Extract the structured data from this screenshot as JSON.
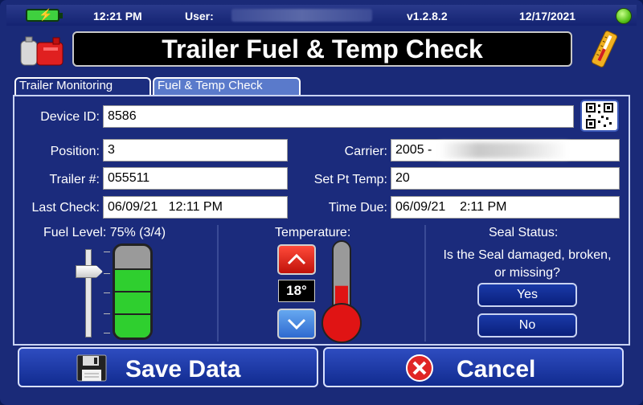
{
  "status": {
    "time": "12:21 PM",
    "user_label": "User:",
    "version": "v1.2.8.2",
    "date": "12/17/2021"
  },
  "title": "Trailer Fuel & Temp Check",
  "tabs": [
    {
      "label": "Trailer Monitoring",
      "active": false
    },
    {
      "label": "Fuel & Temp Check",
      "active": true
    }
  ],
  "form": {
    "device_id": {
      "label": "Device ID:",
      "value": "8586"
    },
    "position": {
      "label": "Position:",
      "value": "3"
    },
    "carrier": {
      "label": "Carrier:",
      "value": "2005 -"
    },
    "trailer": {
      "label": "Trailer #:",
      "value": "055511"
    },
    "set_pt_temp": {
      "label": "Set Pt Temp:",
      "value": "20"
    },
    "last_check": {
      "label": "Last Check:",
      "value": "06/09/21   12:11 PM"
    },
    "time_due": {
      "label": "Time Due:",
      "value": "06/09/21    2:11 PM"
    }
  },
  "fuel": {
    "label": "Fuel Level: 75% (3/4)",
    "level": 0.75
  },
  "temperature": {
    "label": "Temperature:",
    "value": "18°",
    "level": 0.45
  },
  "seal": {
    "label": "Seal Status:",
    "question": "Is the Seal damaged, broken, or missing?",
    "yes_label": "Yes",
    "no_label": "No"
  },
  "actions": {
    "save_label": "Save Data",
    "cancel_label": "Cancel"
  },
  "colors": {
    "background": "#1b2b7c",
    "button": "#1a3aa8",
    "fuel_fill": "#2fcf2f",
    "temp_up": "#e0201a",
    "temp_down": "#3f80e0",
    "thermometer_fill": "#e01414"
  }
}
